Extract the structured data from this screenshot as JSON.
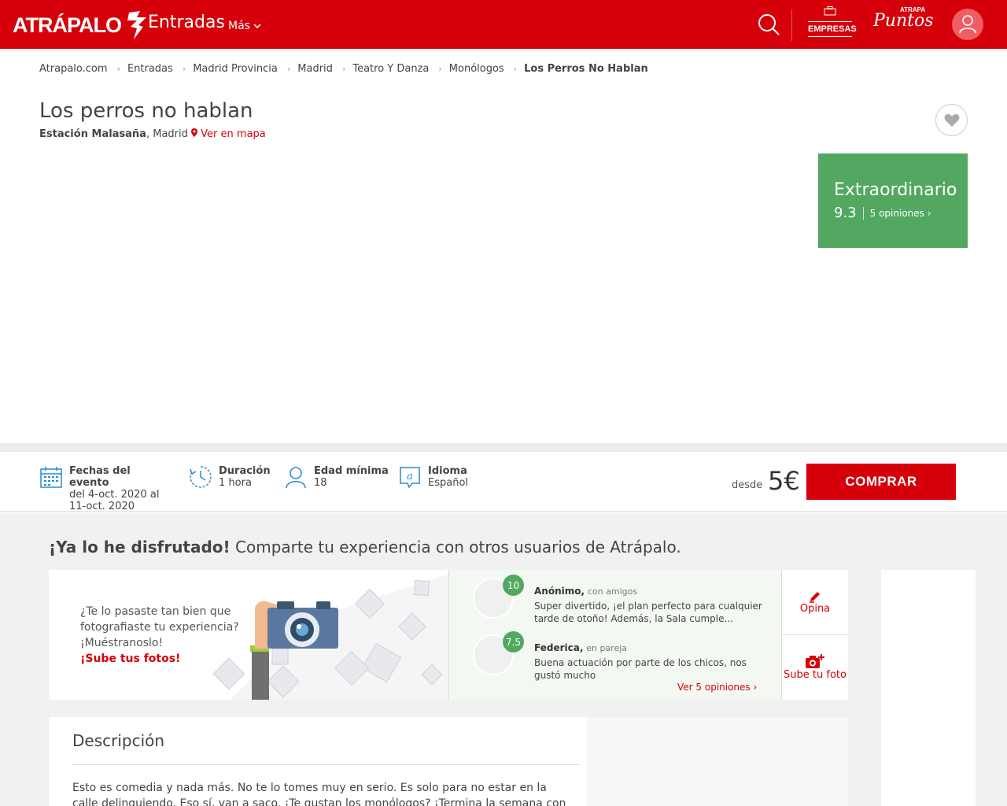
{
  "header": {
    "logo": "ATRÁPALO",
    "section": "Entradas",
    "more": "Más",
    "empresas": "EMPRESAS",
    "puntos_small": "ATRAPA",
    "puntos": "Puntos"
  },
  "breadcrumb": [
    "Atrapalo.com",
    "Entradas",
    "Madrid Provincia",
    "Madrid",
    "Teatro Y Danza",
    "Monólogos",
    "Los Perros No Hablan"
  ],
  "event": {
    "title": "Los perros no hablan",
    "venue": "Estación Malasaña",
    "city": ", Madrid",
    "map_link": "Ver en mapa"
  },
  "rating": {
    "label": "Extraordinario",
    "score": "9.3",
    "opinions": "5 opiniones"
  },
  "info": {
    "dates_label": "Fechas del evento",
    "dates_value": "del 4-oct. 2020 al 11-oct. 2020",
    "duration_label": "Duración",
    "duration_value": "1 hora",
    "age_label": "Edad mínima",
    "age_value": "18",
    "lang_label": "Idioma",
    "lang_value": "Español"
  },
  "purchase": {
    "from": "desde",
    "price": "5€",
    "buy": "COMPRAR"
  },
  "share": {
    "title_bold": "¡Ya lo he disfrutado!",
    "title_rest": " Comparte tu experiencia con otros usuarios de Atrápalo.",
    "photo_text": "¿Te lo pasaste tan bien que fotografiaste tu experiencia? ¡Muéstranoslo!",
    "photo_cta": "¡Sube tus fotos!"
  },
  "reviews": [
    {
      "score": "10",
      "author": "Anónimo,",
      "context": "con amigos",
      "text": "Super divertido, ¡el plan perfecto para cualquier tarde de otoño! Además, la Sala cumple..."
    },
    {
      "score": "7.5",
      "author": "Federica,",
      "context": "en pareja",
      "text": "Buena actuación por parte de los chicos, nos gustó mucho"
    }
  ],
  "reviews_link": "Ver 5 opiniones",
  "actions": {
    "opina": "Opina",
    "upload": "Sube tu foto"
  },
  "description": {
    "heading": "Descripción",
    "text": "Esto es comedia y nada más. No te lo tomes muy en serio. Es solo para no estar en la calle delinquiendo. Eso sí, van a saco. ¡Te gustan los monólogos? ¡Termina la semana con una"
  },
  "colors": {
    "brand": "#d6000a",
    "rating_green": "#52a861",
    "info_icons": "#2a8ad4"
  }
}
